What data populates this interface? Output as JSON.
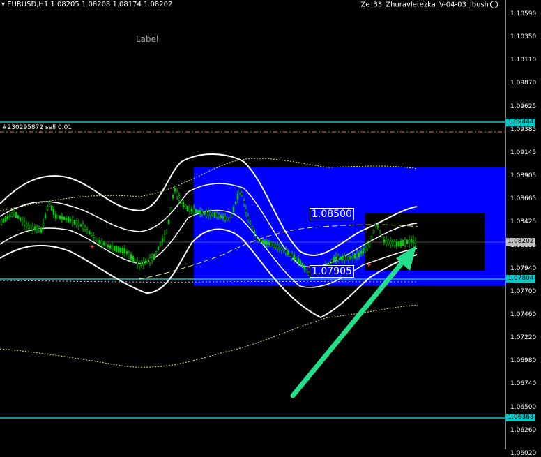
{
  "header": {
    "symbol_info": "EURUSD,H1  1.08205 1.08208 1.08174 1.08202",
    "expert_name": "Ze_33_Zhuravlerezka_V-04-03_Ibush"
  },
  "chart_label": "Label",
  "order_label": "#230295872 sell 0.01",
  "price_boxes": {
    "upper": "1.08500",
    "lower": "1.07905"
  },
  "axis": {
    "ticks": [
      "1.10590",
      "1.10350",
      "1.10110",
      "1.09870",
      "1.09625",
      "1.09385",
      "1.09145",
      "1.08905",
      "1.08665",
      "1.08425",
      "1.08185",
      "1.07940",
      "1.07700",
      "1.07460",
      "1.07220",
      "1.06980",
      "1.06740",
      "1.06500",
      "1.06260",
      "1.06020"
    ],
    "tags": [
      {
        "value": "1.09444",
        "color": "#00c8c8",
        "text_color": "#000000"
      },
      {
        "value": "1.08202",
        "color": "#c0c0c0",
        "text_color": "#000000"
      },
      {
        "value": "1.07804",
        "color": "#00c8c8",
        "text_color": "#000000"
      },
      {
        "value": "1.06363",
        "color": "#00c8c8",
        "text_color": "#000000"
      }
    ]
  },
  "colors": {
    "background": "#000000",
    "zone": "#0000ff",
    "candles": "#00d000",
    "bands": "#ffffff",
    "trend_line": "#00c8c8",
    "arrow": "#22e08a",
    "dashed_yellow": "#e8e860"
  }
}
